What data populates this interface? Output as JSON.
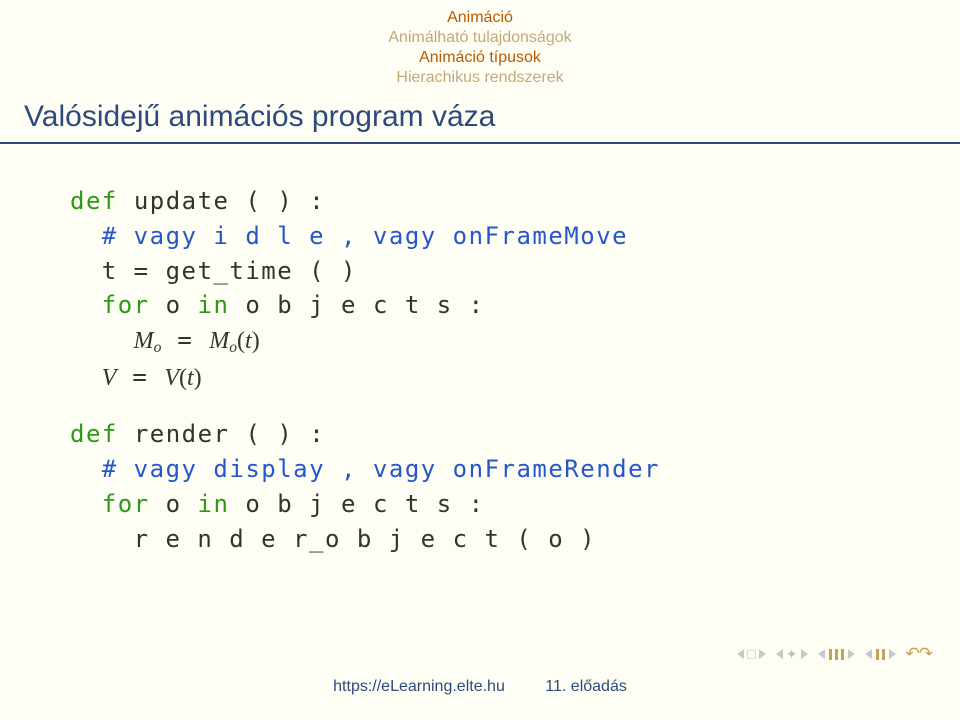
{
  "header": {
    "line1": "Animáció",
    "line2": "Animálható tulajdonságok",
    "line3": "Animáció típusok",
    "line4": "Hierachikus rendszerek"
  },
  "title": "Valósidejű animációs program váza",
  "code": {
    "def": "def",
    "for_kw": "for",
    "in_kw": "in",
    "update_sig": "update ( ) :",
    "update_comment": "# vagy i d l e , vagy onFrameMove",
    "t_assign_left": "t  = ",
    "get_time": "get",
    "time_word": "time ( )",
    "for_o_in": " o ",
    "objects_colon": " o b j e c t s :",
    "eq": " = ",
    "render_sig": "render ( ) :",
    "render_comment": "# vagy display , vagy onFrameRender",
    "render_call": "r e n d e r",
    "object_word": "o b j e c t ( o )",
    "M": "M",
    "V": "V",
    "o": "o",
    "t": "t"
  },
  "footer": {
    "url": "https://eLearning.elte.hu",
    "page": "11. előadás"
  }
}
